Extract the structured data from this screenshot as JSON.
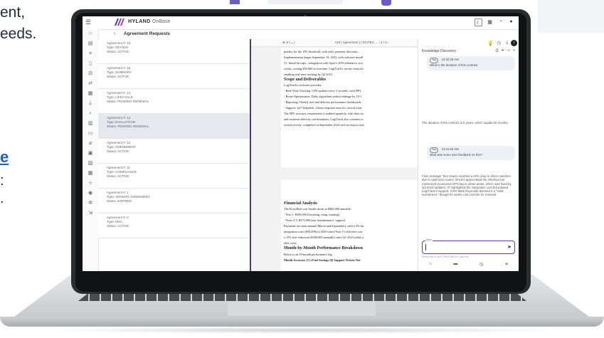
{
  "background": {
    "lines": [
      "ent,",
      "eeds."
    ],
    "link_fragment": "e",
    "tail_fragment": ":",
    "tail_fragment2": "."
  },
  "app": {
    "logo_text": "HYLAND",
    "logo_product": "OnBase",
    "header_icons": [
      "moon-icon",
      "grid-icon",
      "bell-icon",
      "user-icon"
    ]
  },
  "subheader": {
    "back_glyph": "‹",
    "title": "Agreement Requests"
  },
  "agreements": [
    {
      "number": "Agreement #: 16",
      "type": "Type: REVIEW",
      "status": "Status: ACTIVE",
      "selected": false
    },
    {
      "number": "Agreement #: 15",
      "type": "Type: SUMMARY",
      "status": "Status: ACTIVE",
      "selected": false
    },
    {
      "number": "Agreement #: 14",
      "type": "Type: LIFECYCLE",
      "status": "Status: PENDING RENEWAL",
      "selected": false
    },
    {
      "number": "Agreement #: 13",
      "type": "Type: EVALUATION",
      "status": "Status: PENDING RENEWAL",
      "selected": true
    },
    {
      "number": "Agreement #: 12",
      "type": "Type: AMENDMENT",
      "status": "Status: ACTIVE",
      "selected": false
    },
    {
      "number": "Agreement #: 11",
      "type": "Type: COMPLIANCE",
      "status": "Status: ACTIVE",
      "selected": false
    },
    {
      "number": "Agreement #: 1",
      "type": "Type: VENDOR AGREEMENT",
      "status": "Status: EXPIRED",
      "selected": false
    },
    {
      "number": "Agreement #: 2",
      "type": "Type: MSA",
      "status": "Status: ACTIVE",
      "selected": false
    }
  ],
  "viewer": {
    "zoom_controls": "⊕  ⊖  |↔|",
    "doc_title": "CM | Agreement | | DAITEC ...   ‹ 2 / 2 ›",
    "page1": {
      "p0": "penalty for the 10% threshold, with early payment discounts.",
      "p1a": "Implementation began September 15, 2023, with software install",
      "p1b": "31. Initial hiccups—integration with Apex's 2019 telematics syst",
      "p1c": "weeks, costing $50,000 in overtime. LogiTrack's on-site team res",
      "p1d": "enabling real-time tracking by Q4 2023.",
      "h_scope": "Scope and Deliverables",
      "p2": "LogiTrack's software provides:",
      "b1": "- Real-Time Tracking: GPS updates every 5 seconds, with 98%",
      "b2": "- Route Optimization: Daily algorithms reduce mileage by 10-1",
      "b3": "- Reporting: Weekly fuel and delivery performance dashboards.",
      "b4": "- Support: 24/7 helpdesk, 4-hour response time for critical issue",
      "p3a": "The 98% accuracy requirement is audited quarterly, with data cro",
      "p3b": "and customer delivery confirmations. LogiTrack also commits to",
      "p3c": "system review, completed in September 2024 with no major issue"
    },
    "page2": {
      "h_fin": "Financial Analysis",
      "p1": "The $2 million cost breaks down to $400,000 annually:",
      "b1": "- Year 1: $500,000 (licensing, setup, training)",
      "b2": "- Years 2-5: $375,000/year (maintenance, support)",
      "p2a": "Payments are semi-annual (March and September), with a 5% lat",
      "p2b": "integration costs ($50,000) in 2023 raised Year 1's effective cost",
      "p2c": "a 15% fuel reduction ($300,000 annually) since Q1 2024 yields a",
      "p2d": "after costs.",
      "h_month": "Month-by-Month Performance Breakdown",
      "p3": "Below is an 18-month performance log:",
      "t_head": "Month     Accuracy (%) Fuel Savings ($) Support Tickets Not"
    }
  },
  "knowledge": {
    "title": "Knowledge Discovery",
    "icons": [
      "print-icon",
      "send-icon",
      "share-icon",
      "filter-icon"
    ],
    "q1": {
      "chip": "You",
      "time": "10:32:29 AM",
      "text": "What is the duration of this contract"
    },
    "a1": "The duration of the contract is 5 years, which equals 60 months.",
    "q2": {
      "chip": "You",
      "time": "10:41:52 AM",
      "text": "what was some user feedback on this?"
    },
    "a2": "Fleet manager Tom Hayes reported a 20% drop in driver overtime due to optimized routes. Drivers appreciated the interface but mentioned occasional GPS lag in urban areas, which was fixed by Q3 2024 updates. I'll highlighted the integration cost but praised LogiTrack's support. COO Mark Reynolds deemed it a \"solid investment,\" though he seeks cost controls for renewal.",
    "input_label": "Input",
    "input_value": "",
    "send_glyph": "➤",
    "hint": "Press Enter to send, Shift+Enter for a new line.",
    "bottom_icons": [
      "home-icon",
      "folder-icon",
      "history-icon",
      "sparkle-icon"
    ]
  }
}
